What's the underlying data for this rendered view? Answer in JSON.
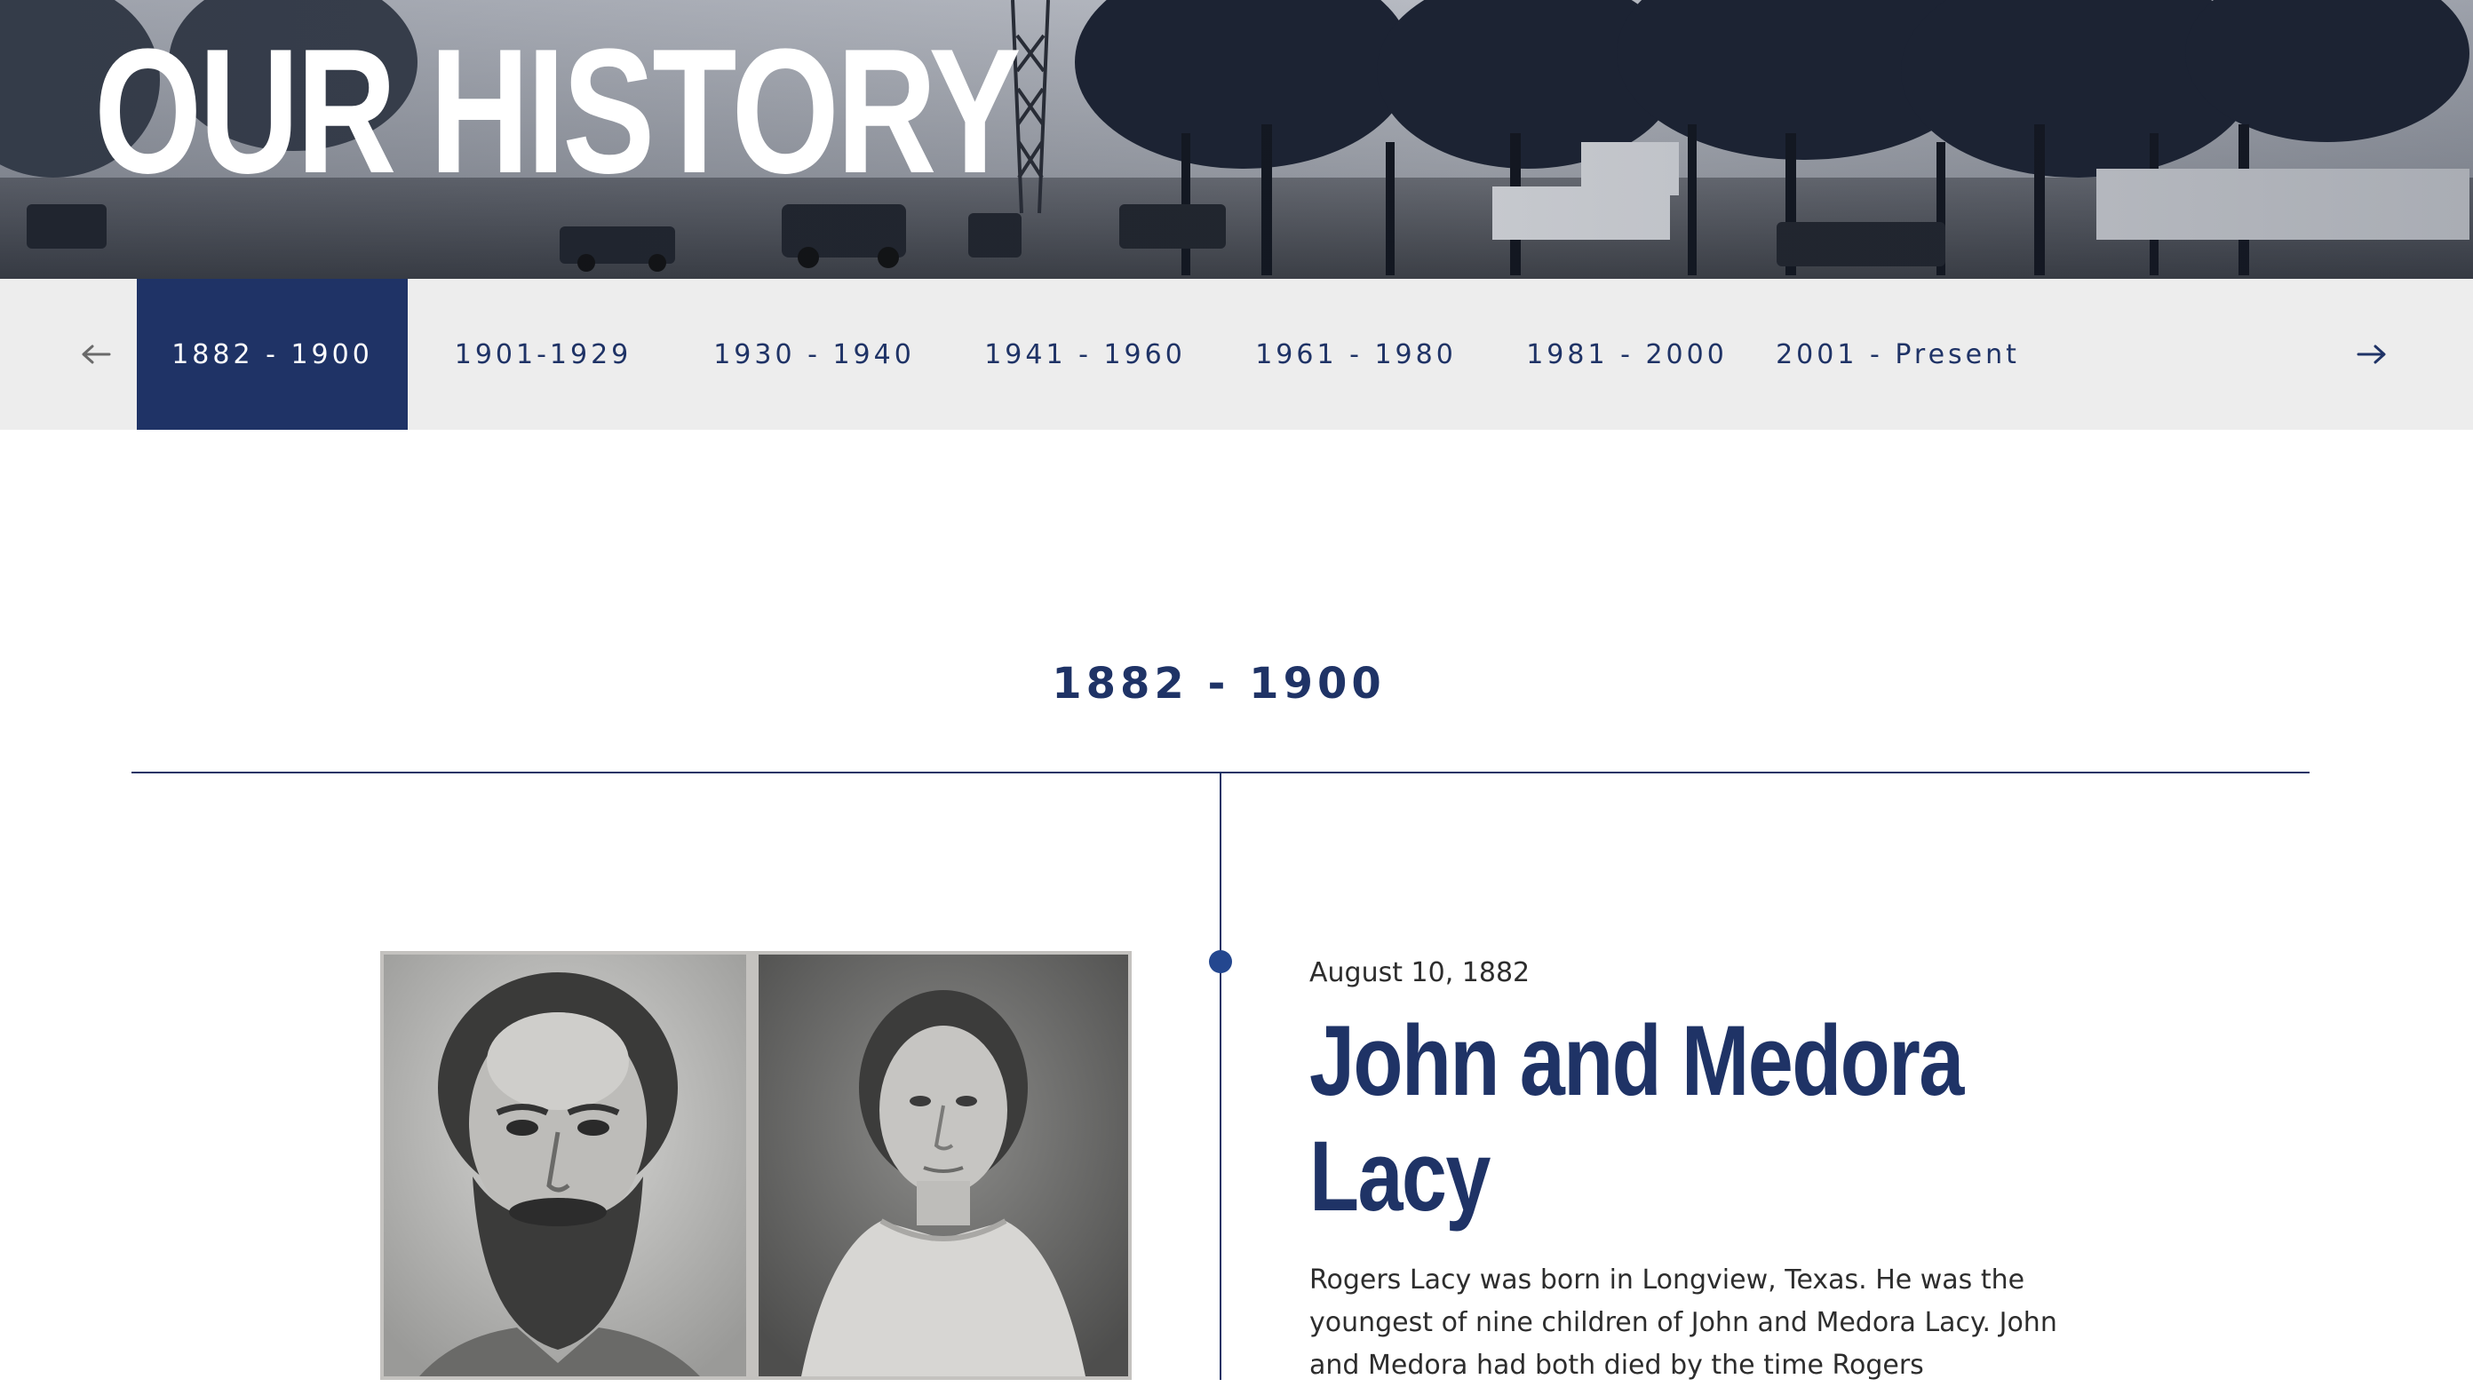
{
  "hero": {
    "title": "OUR HISTORY"
  },
  "era_nav": {
    "prev_icon": "arrow-left-icon",
    "next_icon": "arrow-right-icon",
    "active_index": 0,
    "tabs": [
      {
        "label": "1882 - 1900"
      },
      {
        "label": "1901-1929"
      },
      {
        "label": "1930 - 1940"
      },
      {
        "label": "1941 - 1960"
      },
      {
        "label": "1961 - 1980"
      },
      {
        "label": "1981 - 2000"
      },
      {
        "label": "2001 - Present"
      }
    ]
  },
  "section": {
    "heading": "1882 - 1900"
  },
  "entry": {
    "date": "August 10, 1882",
    "title": "John and Medora Lacy",
    "body": "Rogers Lacy was born in Longview, Texas. He was the youngest of nine children of John and Medora Lacy. John and Medora had both died by the time Rogers"
  },
  "colors": {
    "navy": "#1f3366",
    "nav_background": "#ededed",
    "dot": "#24478f",
    "body_text": "#2d2d2d"
  }
}
